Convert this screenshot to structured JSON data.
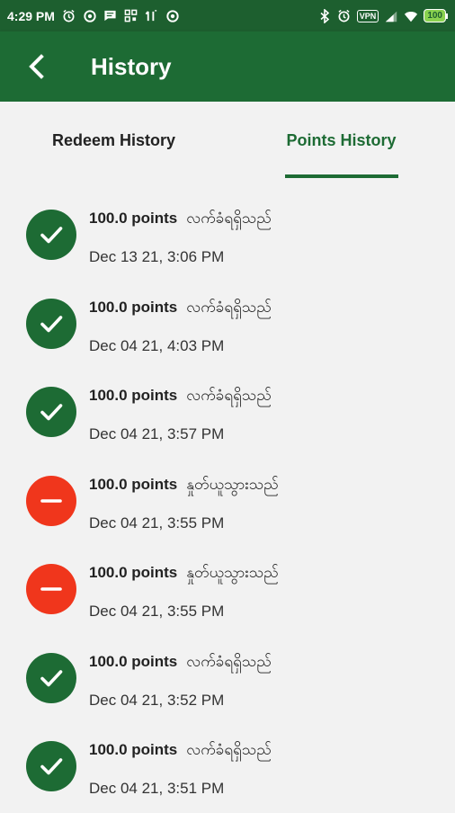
{
  "status_bar": {
    "time": "4:29 PM",
    "battery": "100",
    "vpn_label": "VPN",
    "left_icons": [
      "alarm-icon",
      "circle-icon",
      "message-icon",
      "image-icon",
      "qr-icon",
      "signal-icon",
      "circle-icon"
    ],
    "right_icons": [
      "bluetooth-icon",
      "alarm-icon",
      "vpn-icon",
      "cell-signal-icon",
      "wifi-icon",
      "battery-icon"
    ]
  },
  "app_bar": {
    "title": "History",
    "back_icon": "arrow-back-icon"
  },
  "tabs": [
    {
      "label": "Redeem History",
      "selected": false
    },
    {
      "label": "Points History",
      "selected": true
    }
  ],
  "items": [
    {
      "points": "100.0 points",
      "status": "လက်ခံရရှိသည်",
      "date": "Dec 13 21, 3:06 PM",
      "type": "received"
    },
    {
      "points": "100.0 points",
      "status": "လက်ခံရရှိသည်",
      "date": "Dec 04 21, 4:03 PM",
      "type": "received"
    },
    {
      "points": "100.0 points",
      "status": "လက်ခံရရှိသည်",
      "date": "Dec 04 21, 3:57 PM",
      "type": "received"
    },
    {
      "points": "100.0 points",
      "status": "နှုတ်ယူသွားသည်",
      "date": "Dec 04 21, 3:55 PM",
      "type": "deducted"
    },
    {
      "points": "100.0 points",
      "status": "နှုတ်ယူသွားသည်",
      "date": "Dec 04 21, 3:55 PM",
      "type": "deducted"
    },
    {
      "points": "100.0 points",
      "status": "လက်ခံရရှိသည်",
      "date": "Dec 04 21, 3:52 PM",
      "type": "received"
    },
    {
      "points": "100.0 points",
      "status": "လက်ခံရရှိသည်",
      "date": "Dec 04 21, 3:51 PM",
      "type": "received"
    }
  ],
  "colors": {
    "primary": "#1d6b34",
    "status_bar": "#1d5f2f",
    "deducted": "#f0361c",
    "background": "#f2f2f2"
  }
}
